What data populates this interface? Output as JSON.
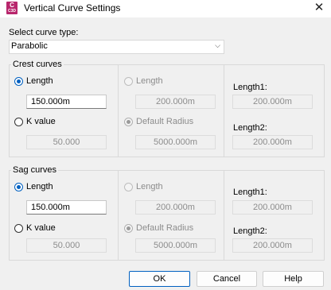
{
  "window": {
    "title": "Vertical Curve Settings",
    "app_icon_letter": "C",
    "app_icon_sub": "C3D",
    "close_symbol": "✕"
  },
  "curve_type": {
    "label": "Select curve type:",
    "value": "Parabolic",
    "chevron": "⌵"
  },
  "crest": {
    "legend": "Crest curves",
    "length_label": "Length",
    "length_value": "150.000m",
    "k_label": "K value",
    "k_value": "50.000",
    "mid_length_label": "Length",
    "mid_length_value": "200.000m",
    "default_radius_label": "Default Radius",
    "default_radius_value": "5000.000m",
    "length1_label": "Length1:",
    "length1_value": "200.000m",
    "length2_label": "Length2:",
    "length2_value": "200.000m"
  },
  "sag": {
    "legend": "Sag curves",
    "length_label": "Length",
    "length_value": "150.000m",
    "k_label": "K value",
    "k_value": "50.000",
    "mid_length_label": "Length",
    "mid_length_value": "200.000m",
    "default_radius_label": "Default Radius",
    "default_radius_value": "5000.000m",
    "length1_label": "Length1:",
    "length1_value": "200.000m",
    "length2_label": "Length2:",
    "length2_value": "200.000m"
  },
  "buttons": {
    "ok": "OK",
    "cancel": "Cancel",
    "help": "Help"
  }
}
